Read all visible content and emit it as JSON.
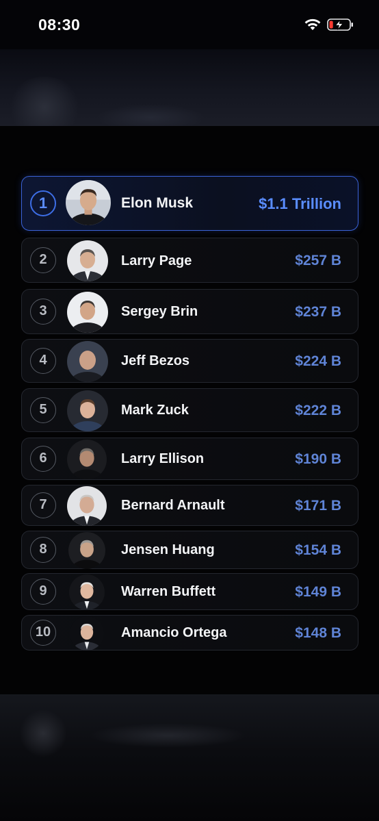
{
  "status_bar": {
    "time": "08:30",
    "wifi_icon": "wifi-icon",
    "battery_icon": "battery-charging-icon",
    "battery_level_fraction": 0.15,
    "battery_color": "#ff3b30"
  },
  "leaderboard": {
    "accent_color": "#3b63d8",
    "entries": [
      {
        "rank": "1",
        "name": "Elon Musk",
        "net_worth": "$1.1 Trillion",
        "avatar": "elon-musk-avatar"
      },
      {
        "rank": "2",
        "name": "Larry Page",
        "net_worth": "$257 B",
        "avatar": "larry-page-avatar"
      },
      {
        "rank": "3",
        "name": "Sergey Brin",
        "net_worth": "$237 B",
        "avatar": "sergey-brin-avatar"
      },
      {
        "rank": "4",
        "name": "Jeff Bezos",
        "net_worth": "$224 B",
        "avatar": "jeff-bezos-avatar"
      },
      {
        "rank": "5",
        "name": "Mark Zuck",
        "net_worth": "$222 B",
        "avatar": "mark-zuck-avatar"
      },
      {
        "rank": "6",
        "name": "Larry Ellison",
        "net_worth": "$190 B",
        "avatar": "larry-ellison-avatar"
      },
      {
        "rank": "7",
        "name": "Bernard Arnault",
        "net_worth": "$171 B",
        "avatar": "bernard-arnault-avatar"
      },
      {
        "rank": "8",
        "name": "Jensen Huang",
        "net_worth": "$154 B",
        "avatar": "jensen-huang-avatar"
      },
      {
        "rank": "9",
        "name": "Warren Buffett",
        "net_worth": "$149 B",
        "avatar": "warren-buffett-avatar"
      },
      {
        "rank": "10",
        "name": "Amancio Ortega",
        "net_worth": "$148 B",
        "avatar": "amancio-ortega-avatar"
      }
    ]
  }
}
